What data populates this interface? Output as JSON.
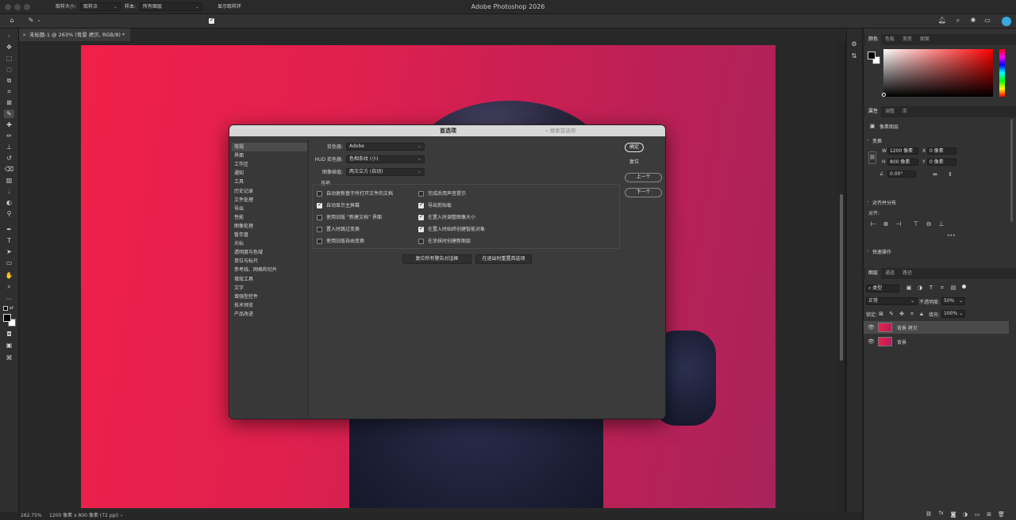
{
  "app_title": "Adobe Photoshop 2026",
  "options_bar": {
    "sample_size_label": "取样大小:",
    "sample_size_value": "取样点",
    "sample_label": "样本:",
    "sample_value": "所有图层",
    "show_ring_label": "显示取样环",
    "show_ring_checked": true
  },
  "document_tab": {
    "title": "未标题-1 @ 263% (背景 拷贝, RGB/8) *"
  },
  "status": {
    "zoom": "262.75%",
    "doc_info": "1200 像素 x 800 像素 (72 ppi)",
    "arrow": "›"
  },
  "panels": {
    "color_tabs": [
      "颜色",
      "色板",
      "渐变",
      "图案"
    ],
    "properties_tabs": [
      "属性",
      "调整",
      "库"
    ],
    "properties_kind": "像素图层",
    "transform_title": "变换",
    "w_label": "W",
    "w_value": "1200 像素",
    "x_label": "X",
    "x_value": "0 像素",
    "h_label": "H",
    "h_value": "800 像素",
    "y_label": "Y",
    "y_value": "0 像素",
    "angle_value": "0.00°",
    "align_title": "对齐并分布",
    "align_label": "对齐:",
    "more": "•••",
    "quick_actions_title": "快速操作",
    "layers_tabs": [
      "图层",
      "通道",
      "路径"
    ],
    "filter_kind": "类型",
    "blend_mode": "正常",
    "opacity_label": "不透明度:",
    "opacity_value": "50%",
    "lock_label": "锁定:",
    "fill_label": "填充:",
    "fill_value": "100%",
    "layers": [
      {
        "name": "背景 拷贝",
        "selected": true
      },
      {
        "name": "背景",
        "selected": false
      }
    ],
    "footer_fx": "fx"
  },
  "dialog": {
    "title": "首选项",
    "search_placeholder": "搜索首选项",
    "nav": [
      "常规",
      "界面",
      "工作区",
      "通知",
      "工具",
      "历史记录",
      "文件处理",
      "导出",
      "性能",
      "图像处理",
      "暂存盘",
      "光标",
      "透明度与色域",
      "单位与标尺",
      "参考线、网格和切片",
      "增效工具",
      "文字",
      "增强型控件",
      "技术预览",
      "产品改进"
    ],
    "picker_label": "拾色器:",
    "picker_value": "Adobe",
    "hud_label": "HUD 拾色器:",
    "hud_value": "色相条纹 (小)",
    "interp_label": "图像插值:",
    "interp_value": "两次立方 (自动)",
    "options_title": "选项",
    "options_left": [
      {
        "label": "自动更新基于所打开文件的文档",
        "checked": false
      },
      {
        "label": "自动显示主屏幕",
        "checked": true
      },
      {
        "label": "使用旧版 “新建文档” 界面",
        "checked": false
      },
      {
        "label": "置入时跳过变换",
        "checked": false
      },
      {
        "label": "使用旧版自由变换",
        "checked": false
      }
    ],
    "options_right": [
      {
        "label": "完成后用声音提示",
        "checked": false
      },
      {
        "label": "导出剪贴板",
        "checked": true
      },
      {
        "label": "在置入时调整图像大小",
        "checked": true
      },
      {
        "label": "在置入时始终创建智能对象",
        "checked": true
      },
      {
        "label": "在涂抹时创建新图层",
        "checked": false
      }
    ],
    "reset_warnings": "复位所有警告对话框",
    "reset_on_quit": "在退出时重置首选项",
    "ok": "确定",
    "reset": "复位",
    "prev": "上一个",
    "next": "下一个"
  }
}
